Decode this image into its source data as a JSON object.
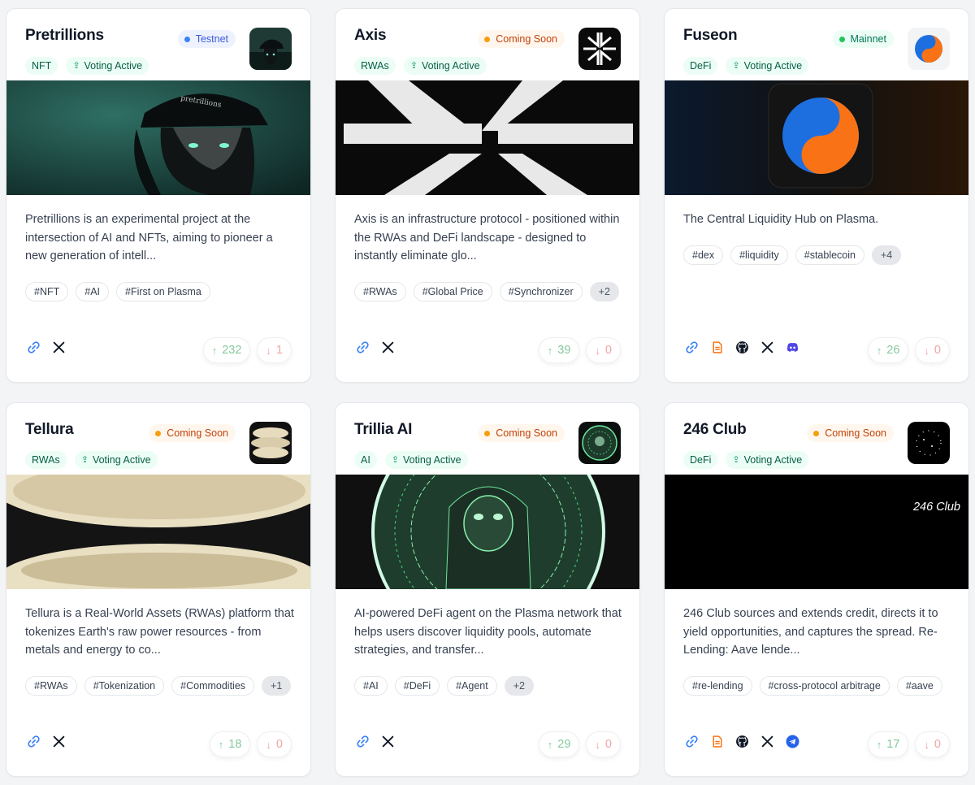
{
  "projects": [
    {
      "name": "Pretrillions",
      "status": "Testnet",
      "category": "NFT",
      "voting": "Voting Active",
      "description": "Pretrillions is an experimental project at the intersection of AI and NFTs, aiming to pioneer a new generation of intell...",
      "tags": [
        "#NFT",
        "#AI",
        "#First on Plasma"
      ],
      "more_tags": "",
      "upvotes": "232",
      "downvotes": "1",
      "links": [
        "link-icon",
        "x-icon"
      ]
    },
    {
      "name": "Axis",
      "status": "Coming Soon",
      "category": "RWAs",
      "voting": "Voting Active",
      "description": "Axis is an infrastructure protocol - positioned within the RWAs and DeFi landscape - designed to instantly eliminate glo...",
      "tags": [
        "#RWAs",
        "#Global Price",
        "#Synchronizer"
      ],
      "more_tags": "+2",
      "upvotes": "39",
      "downvotes": "0",
      "links": [
        "link-icon",
        "x-icon"
      ]
    },
    {
      "name": "Fuseon",
      "status": "Mainnet",
      "category": "DeFi",
      "voting": "Voting Active",
      "description": "The Central Liquidity Hub on Plasma.",
      "tags": [
        "#dex",
        "#liquidity",
        "#stablecoin"
      ],
      "more_tags": "+4",
      "upvotes": "26",
      "downvotes": "0",
      "links": [
        "link-icon",
        "document-icon",
        "github-icon",
        "x-icon",
        "discord-icon"
      ]
    },
    {
      "name": "Tellura",
      "status": "Coming Soon",
      "category": "RWAs",
      "voting": "Voting Active",
      "description": "Tellura is a Real-World Assets (RWAs) platform that tokenizes Earth's raw power resources - from metals and energy to co...",
      "tags": [
        "#RWAs",
        "#Tokenization",
        "#Commodities"
      ],
      "more_tags": "+1",
      "upvotes": "18",
      "downvotes": "0",
      "links": [
        "link-icon",
        "x-icon"
      ]
    },
    {
      "name": "Trillia AI",
      "status": "Coming Soon",
      "category": "AI",
      "voting": "Voting Active",
      "description": "AI-powered DeFi agent on the Plasma network that helps users discover liquidity pools, automate strategies, and transfer...",
      "tags": [
        "#AI",
        "#DeFi",
        "#Agent"
      ],
      "more_tags": "+2",
      "upvotes": "29",
      "downvotes": "0",
      "links": [
        "link-icon",
        "x-icon"
      ]
    },
    {
      "name": "246 Club",
      "status": "Coming Soon",
      "category": "DeFi",
      "voting": "Voting Active",
      "description": "246 Club sources and extends credit, directs it to yield opportunities, and captures the spread. Re-Lending: Aave lende...",
      "tags": [
        "#re-lending",
        "#cross-protocol arbitrage",
        "#aave"
      ],
      "more_tags": "",
      "upvotes": "17",
      "downvotes": "0",
      "links": [
        "link-icon",
        "document-icon",
        "github-icon",
        "x-icon",
        "telegram-icon"
      ],
      "banner_text": "246 Club"
    }
  ],
  "colors": {
    "testnet": "#3b82f6",
    "coming_soon": "#f59e0b",
    "mainnet": "#22c55e",
    "category_pill": "#ecfdf5",
    "upvote": "#86c99b",
    "downvote": "#f0a4a4"
  }
}
